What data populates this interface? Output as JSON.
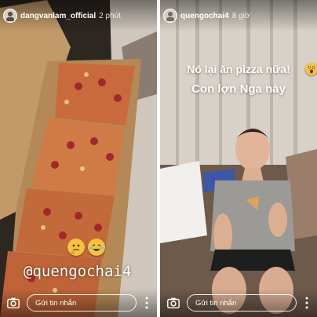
{
  "stories": [
    {
      "header": {
        "username": "dangvanlam_official",
        "time": "2 phút"
      },
      "stickers": {
        "mention": "@quengochai4",
        "emojis": [
          "thinking-face",
          "rolling-laughing-face"
        ]
      },
      "footer": {
        "reply_placeholder": "Gửi tin nhắn"
      }
    },
    {
      "header": {
        "username": "quengochai4",
        "time": "8 giờ"
      },
      "caption": {
        "line1": "Nó lại ăn pizza nữa!",
        "line2": "Con lợn Nga này"
      },
      "footer": {
        "reply_placeholder": "Gửi tin nhắn"
      }
    }
  ]
}
